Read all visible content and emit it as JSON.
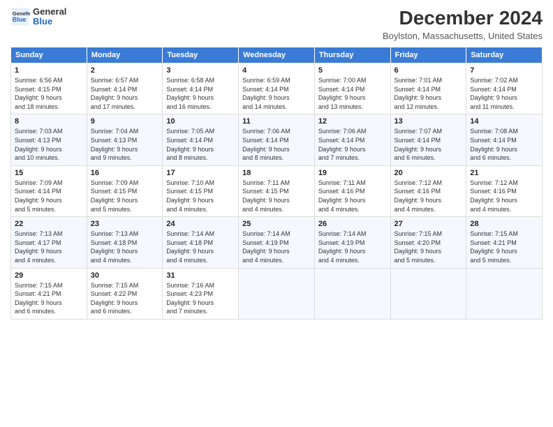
{
  "logo": {
    "general": "General",
    "blue": "Blue"
  },
  "header": {
    "title": "December 2024",
    "location": "Boylston, Massachusetts, United States"
  },
  "days_of_week": [
    "Sunday",
    "Monday",
    "Tuesday",
    "Wednesday",
    "Thursday",
    "Friday",
    "Saturday"
  ],
  "weeks": [
    [
      {
        "day": "1",
        "sunrise": "6:56 AM",
        "sunset": "4:15 PM",
        "daylight": "9 hours and 18 minutes."
      },
      {
        "day": "2",
        "sunrise": "6:57 AM",
        "sunset": "4:14 PM",
        "daylight": "9 hours and 17 minutes."
      },
      {
        "day": "3",
        "sunrise": "6:58 AM",
        "sunset": "4:14 PM",
        "daylight": "9 hours and 16 minutes."
      },
      {
        "day": "4",
        "sunrise": "6:59 AM",
        "sunset": "4:14 PM",
        "daylight": "9 hours and 14 minutes."
      },
      {
        "day": "5",
        "sunrise": "7:00 AM",
        "sunset": "4:14 PM",
        "daylight": "9 hours and 13 minutes."
      },
      {
        "day": "6",
        "sunrise": "7:01 AM",
        "sunset": "4:14 PM",
        "daylight": "9 hours and 12 minutes."
      },
      {
        "day": "7",
        "sunrise": "7:02 AM",
        "sunset": "4:14 PM",
        "daylight": "9 hours and 11 minutes."
      }
    ],
    [
      {
        "day": "8",
        "sunrise": "7:03 AM",
        "sunset": "4:13 PM",
        "daylight": "9 hours and 10 minutes."
      },
      {
        "day": "9",
        "sunrise": "7:04 AM",
        "sunset": "4:13 PM",
        "daylight": "9 hours and 9 minutes."
      },
      {
        "day": "10",
        "sunrise": "7:05 AM",
        "sunset": "4:14 PM",
        "daylight": "9 hours and 8 minutes."
      },
      {
        "day": "11",
        "sunrise": "7:06 AM",
        "sunset": "4:14 PM",
        "daylight": "9 hours and 8 minutes."
      },
      {
        "day": "12",
        "sunrise": "7:06 AM",
        "sunset": "4:14 PM",
        "daylight": "9 hours and 7 minutes."
      },
      {
        "day": "13",
        "sunrise": "7:07 AM",
        "sunset": "4:14 PM",
        "daylight": "9 hours and 6 minutes."
      },
      {
        "day": "14",
        "sunrise": "7:08 AM",
        "sunset": "4:14 PM",
        "daylight": "9 hours and 6 minutes."
      }
    ],
    [
      {
        "day": "15",
        "sunrise": "7:09 AM",
        "sunset": "4:14 PM",
        "daylight": "9 hours and 5 minutes."
      },
      {
        "day": "16",
        "sunrise": "7:09 AM",
        "sunset": "4:15 PM",
        "daylight": "9 hours and 5 minutes."
      },
      {
        "day": "17",
        "sunrise": "7:10 AM",
        "sunset": "4:15 PM",
        "daylight": "9 hours and 4 minutes."
      },
      {
        "day": "18",
        "sunrise": "7:11 AM",
        "sunset": "4:15 PM",
        "daylight": "9 hours and 4 minutes."
      },
      {
        "day": "19",
        "sunrise": "7:11 AM",
        "sunset": "4:16 PM",
        "daylight": "9 hours and 4 minutes."
      },
      {
        "day": "20",
        "sunrise": "7:12 AM",
        "sunset": "4:16 PM",
        "daylight": "9 hours and 4 minutes."
      },
      {
        "day": "21",
        "sunrise": "7:12 AM",
        "sunset": "4:16 PM",
        "daylight": "9 hours and 4 minutes."
      }
    ],
    [
      {
        "day": "22",
        "sunrise": "7:13 AM",
        "sunset": "4:17 PM",
        "daylight": "9 hours and 4 minutes."
      },
      {
        "day": "23",
        "sunrise": "7:13 AM",
        "sunset": "4:18 PM",
        "daylight": "9 hours and 4 minutes."
      },
      {
        "day": "24",
        "sunrise": "7:14 AM",
        "sunset": "4:18 PM",
        "daylight": "9 hours and 4 minutes."
      },
      {
        "day": "25",
        "sunrise": "7:14 AM",
        "sunset": "4:19 PM",
        "daylight": "9 hours and 4 minutes."
      },
      {
        "day": "26",
        "sunrise": "7:14 AM",
        "sunset": "4:19 PM",
        "daylight": "9 hours and 4 minutes."
      },
      {
        "day": "27",
        "sunrise": "7:15 AM",
        "sunset": "4:20 PM",
        "daylight": "9 hours and 5 minutes."
      },
      {
        "day": "28",
        "sunrise": "7:15 AM",
        "sunset": "4:21 PM",
        "daylight": "9 hours and 5 minutes."
      }
    ],
    [
      {
        "day": "29",
        "sunrise": "7:15 AM",
        "sunset": "4:21 PM",
        "daylight": "9 hours and 6 minutes."
      },
      {
        "day": "30",
        "sunrise": "7:15 AM",
        "sunset": "4:22 PM",
        "daylight": "9 hours and 6 minutes."
      },
      {
        "day": "31",
        "sunrise": "7:16 AM",
        "sunset": "4:23 PM",
        "daylight": "9 hours and 7 minutes."
      },
      null,
      null,
      null,
      null
    ]
  ],
  "labels": {
    "sunrise": "Sunrise:",
    "sunset": "Sunset:",
    "daylight": "Daylight:"
  }
}
